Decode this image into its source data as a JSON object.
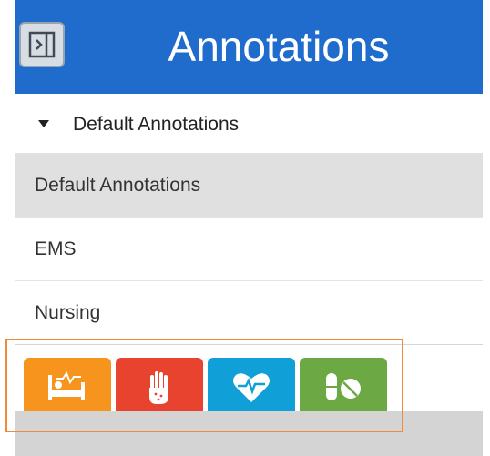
{
  "header": {
    "title": "Annotations",
    "toggle_icon": "sidebar-toggle-icon"
  },
  "dropdown": {
    "label": "Default Annotations",
    "icon": "caret-down-icon"
  },
  "list": {
    "items": [
      {
        "label": "Default Annotations",
        "selected": true
      },
      {
        "label": "EMS",
        "selected": false
      },
      {
        "label": "Nursing",
        "selected": false
      }
    ]
  },
  "toolbar": {
    "buttons": [
      {
        "icon": "bed-icon",
        "color": "#f7941d"
      },
      {
        "icon": "hand-icon",
        "color": "#e8432f"
      },
      {
        "icon": "heart-rate-icon",
        "color": "#119fd8"
      },
      {
        "icon": "pills-icon",
        "color": "#6ca843"
      }
    ],
    "highlight_color": "#f08a3c"
  },
  "colors": {
    "header": "#1f6ccc",
    "selected_row": "#e0e0e0"
  }
}
